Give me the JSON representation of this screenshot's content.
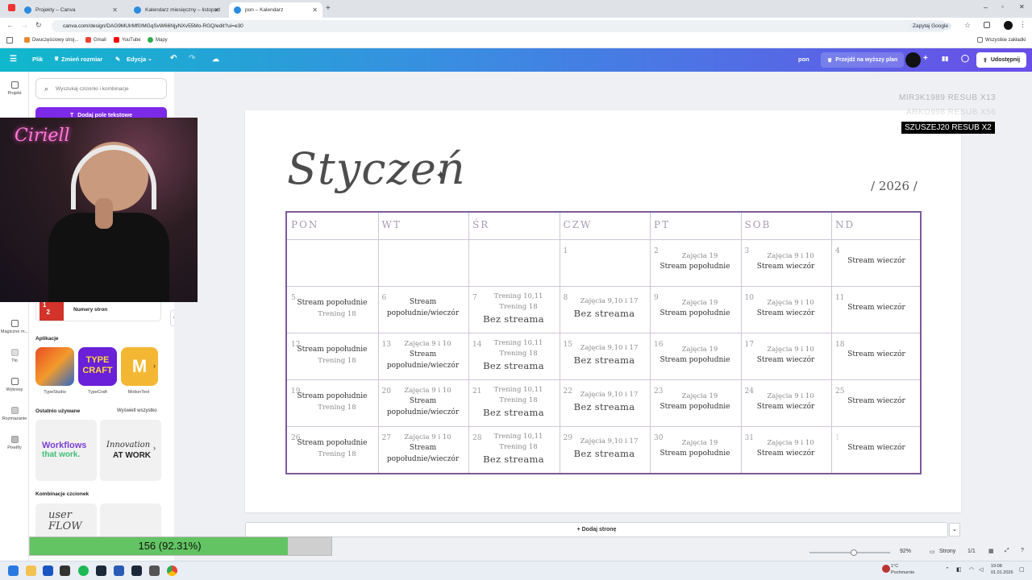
{
  "browser": {
    "tabs": [
      {
        "label": "Projekty – Canva",
        "color": "#2b8be0"
      },
      {
        "label": "Kalendarz miesięczny – listopad",
        "color": "#2b8be0"
      },
      {
        "label": "pon – Kalendarz",
        "color": "#2b8be0"
      }
    ],
    "url": "canva.com/design/DAG9MUlrMf0/MGqSvW66NjyNXv55Mo-RGQ/edit?ui=e30",
    "ask_google": "Zapytaj Google",
    "bookmarks": [
      "Dwuczęściowy stroj...",
      "Gmail",
      "YouTube",
      "Mapy"
    ],
    "all_bookmarks": "Wszystkie zakładki"
  },
  "header": {
    "file": "Plik",
    "resize": "Zmień rozmiar",
    "edit": "Edycja",
    "title": "pon",
    "upgrade": "Przejdź na wyższy plan",
    "share": "Udostępnij"
  },
  "rail": {
    "items": [
      "Projekt",
      "Magiczne m...",
      "Tło",
      "Wykresy",
      "Rozmazanie",
      "Pixelify"
    ]
  },
  "panel": {
    "search_placeholder": "Wyszukaj czcionki i kombinacje",
    "add_text": "Dodaj pole tekstowe",
    "page_numbers": "Numery stron",
    "apps_title": "Aplikacje",
    "apps": [
      "TypeStudio",
      "TypeCraft",
      "MotionText"
    ],
    "recent_title": "Ostatnio używane",
    "see_all": "Wyświetl wszystko",
    "recent": [
      "Workflows",
      "that work.",
      "Innovation",
      "AT WORK"
    ],
    "combos_title": "Kombinacje czcionek",
    "combo_preview": "user FLOW"
  },
  "calendar": {
    "month": "Styczeń",
    "sparkle": "✦",
    "year": "/ 2026 /",
    "days": [
      "PON",
      "WT",
      "ŚR",
      "CZW",
      "PT",
      "SOB",
      "ND"
    ],
    "weeks": [
      [
        {
          "num": "",
          "lines": []
        },
        {
          "num": "",
          "lines": []
        },
        {
          "num": "",
          "lines": []
        },
        {
          "num": "1",
          "lines": []
        },
        {
          "num": "2",
          "lines": [
            {
              "t": "Zajęcia 19",
              "s": "sub"
            },
            {
              "t": "Stream popołudnie",
              "s": "main"
            }
          ]
        },
        {
          "num": "3",
          "lines": [
            {
              "t": "Zajęcia 9 i 10",
              "s": "sub"
            },
            {
              "t": "Stream wieczór",
              "s": "main"
            }
          ]
        },
        {
          "num": "4",
          "lines": [
            {
              "t": "Stream wieczór",
              "s": "main"
            }
          ]
        }
      ],
      [
        {
          "num": "5",
          "lines": [
            {
              "t": "Stream popołudnie",
              "s": "main"
            },
            {
              "t": "Trening 18",
              "s": "sub"
            }
          ]
        },
        {
          "num": "6",
          "lines": [
            {
              "t": "Stream",
              "s": "main"
            },
            {
              "t": "popołudnie/wieczór",
              "s": "main"
            }
          ]
        },
        {
          "num": "7",
          "lines": [
            {
              "t": "Trening 10,11",
              "s": "sub"
            },
            {
              "t": "Trening 18",
              "s": "sub"
            },
            {
              "t": "Bez streama",
              "s": "big"
            }
          ]
        },
        {
          "num": "8",
          "lines": [
            {
              "t": "Zajęcia 9,10 i 17",
              "s": "sub"
            },
            {
              "t": "Bez streama",
              "s": "big"
            }
          ]
        },
        {
          "num": "9",
          "lines": [
            {
              "t": "Zajęcia 19",
              "s": "sub"
            },
            {
              "t": "Stream popołudnie",
              "s": "main"
            }
          ]
        },
        {
          "num": "10",
          "lines": [
            {
              "t": "Zajęcia 9 i 10",
              "s": "sub"
            },
            {
              "t": "Stream wieczór",
              "s": "main"
            }
          ]
        },
        {
          "num": "11",
          "lines": [
            {
              "t": "Stream wieczór",
              "s": "main"
            }
          ]
        }
      ],
      [
        {
          "num": "12",
          "lines": [
            {
              "t": "Stream popołudnie",
              "s": "main"
            },
            {
              "t": "Trening 18",
              "s": "sub"
            }
          ]
        },
        {
          "num": "13",
          "lines": [
            {
              "t": "Zajęcia 9 i 10",
              "s": "sub"
            },
            {
              "t": "Stream",
              "s": "main"
            },
            {
              "t": "popołudnie/wieczór",
              "s": "main"
            }
          ]
        },
        {
          "num": "14",
          "lines": [
            {
              "t": "Trening 10,11",
              "s": "sub"
            },
            {
              "t": "Trening 18",
              "s": "sub"
            },
            {
              "t": "Bez streama",
              "s": "big"
            }
          ]
        },
        {
          "num": "15",
          "lines": [
            {
              "t": "Zajęcia 9,10 i 17",
              "s": "sub"
            },
            {
              "t": "Bez streama",
              "s": "big"
            }
          ]
        },
        {
          "num": "16",
          "lines": [
            {
              "t": "Zajęcia 19",
              "s": "sub"
            },
            {
              "t": "Stream popołudnie",
              "s": "main"
            }
          ]
        },
        {
          "num": "17",
          "lines": [
            {
              "t": "Zajęcia 9 i 10",
              "s": "sub"
            },
            {
              "t": "Stream wieczór",
              "s": "main"
            }
          ]
        },
        {
          "num": "18",
          "lines": [
            {
              "t": "Stream wieczór",
              "s": "main"
            }
          ]
        }
      ],
      [
        {
          "num": "19",
          "lines": [
            {
              "t": "Stream popołudnie",
              "s": "main"
            },
            {
              "t": "Trening 18",
              "s": "sub"
            }
          ]
        },
        {
          "num": "20",
          "lines": [
            {
              "t": "Zajęcia 9 i 10",
              "s": "sub"
            },
            {
              "t": "Stream",
              "s": "main"
            },
            {
              "t": "popołudnie/wieczór",
              "s": "main"
            }
          ]
        },
        {
          "num": "21",
          "lines": [
            {
              "t": "Trening 10,11",
              "s": "sub"
            },
            {
              "t": "Trening 18",
              "s": "sub"
            },
            {
              "t": "Bez streama",
              "s": "big"
            }
          ]
        },
        {
          "num": "22",
          "lines": [
            {
              "t": "Zajęcia 9,10 i 17",
              "s": "sub"
            },
            {
              "t": "Bez streama",
              "s": "big"
            }
          ]
        },
        {
          "num": "23",
          "lines": [
            {
              "t": "Zajęcia 19",
              "s": "sub"
            },
            {
              "t": "Stream popołudnie",
              "s": "main"
            }
          ]
        },
        {
          "num": "24",
          "lines": [
            {
              "t": "Zajęcia 9 i 10",
              "s": "sub"
            },
            {
              "t": "Stream wieczór",
              "s": "main"
            }
          ]
        },
        {
          "num": "25",
          "lines": [
            {
              "t": "Stream wieczór",
              "s": "main"
            }
          ]
        }
      ],
      [
        {
          "num": "26",
          "lines": [
            {
              "t": "Stream popołudnie",
              "s": "main"
            },
            {
              "t": "Trening 18",
              "s": "sub"
            }
          ]
        },
        {
          "num": "27",
          "lines": [
            {
              "t": "Zajęcia 9 i 10",
              "s": "sub"
            },
            {
              "t": "Stream",
              "s": "main"
            },
            {
              "t": "popołudnie/wieczór",
              "s": "main"
            }
          ]
        },
        {
          "num": "28",
          "lines": [
            {
              "t": "Trening 10,11",
              "s": "sub"
            },
            {
              "t": "Trening 18",
              "s": "sub"
            },
            {
              "t": "Bez streama",
              "s": "big"
            }
          ]
        },
        {
          "num": "29",
          "lines": [
            {
              "t": "Zajęcia 9,10 i 17",
              "s": "sub"
            },
            {
              "t": "Bez streama",
              "s": "big"
            }
          ]
        },
        {
          "num": "30",
          "lines": [
            {
              "t": "Zajęcia 19",
              "s": "sub"
            },
            {
              "t": "Stream popołudnie",
              "s": "main"
            }
          ]
        },
        {
          "num": "31",
          "lines": [
            {
              "t": "Zajęcia 9 i 10",
              "s": "sub"
            },
            {
              "t": "Stream wieczór",
              "s": "main"
            }
          ]
        },
        {
          "num": "1",
          "lines": [
            {
              "t": "Stream wieczór",
              "s": "main"
            }
          ]
        }
      ]
    ]
  },
  "overlay": {
    "sub1": "MIR3K1989 RESUB X13",
    "sub2": "ARKO998 RESUB X56",
    "sub3": "SZUSZEJ20 RESUB X2",
    "cam_sign": "Ciriell",
    "progress_text": "156 (92.31%)",
    "progress_fraction": 0.9231
  },
  "footer": {
    "add_page": "+ Dodaj stronę",
    "zoom": "92%",
    "pages": "Strony",
    "page_count": "1/1"
  },
  "taskbar": {
    "weather_temp": "1°C",
    "weather_desc": "Pochmurnie",
    "time": "19:08",
    "date": "01.01.2026"
  },
  "colors": {
    "brand_purple": "#7d2ae8",
    "grid_border": "#7e5a9b",
    "progress_green": "#62c462"
  }
}
